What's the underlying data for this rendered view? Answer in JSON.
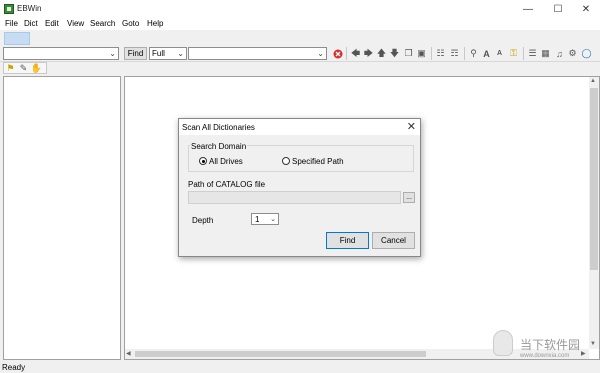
{
  "window": {
    "title": "EBWin"
  },
  "menu": [
    "File",
    "Dict",
    "Edit",
    "View",
    "Search",
    "Goto",
    "Help"
  ],
  "toolbar": {
    "find_label": "Find",
    "mode_value": "Full",
    "search_value": "",
    "dict_value": "",
    "icons": [
      "stop-icon",
      "back-icon",
      "forward-icon",
      "up-icon",
      "down-icon",
      "copy-icon",
      "frame-icon",
      "dict-icon",
      "dict-multi-icon",
      "zoom-icon",
      "font-larger-icon",
      "font-smaller-icon",
      "key-icon",
      "list-icon",
      "image-icon",
      "audio-icon",
      "settings-icon",
      "browser-icon"
    ]
  },
  "toolbar2": {
    "icons": [
      "note-icon",
      "comment-icon",
      "clip-icon"
    ]
  },
  "statusbar": {
    "text": "Ready"
  },
  "dialog": {
    "title": "Scan All Dictionaries",
    "search_domain_label": "Search Domain",
    "all_drives_label": "All Drives",
    "specified_path_label": "Specified Path",
    "selected_domain": "All Drives",
    "path_label": "Path of CATALOG file",
    "path_value": "",
    "browse_label": "...",
    "depth_label": "Depth",
    "depth_value": "1",
    "find_button": "Find",
    "cancel_button": "Cancel"
  },
  "watermark": {
    "text": "当下软件园",
    "url": "www.downxia.com"
  },
  "colors": {
    "accent": "#0078d7",
    "highlight": "#c5dcf3",
    "stop": "#d92b2b"
  }
}
